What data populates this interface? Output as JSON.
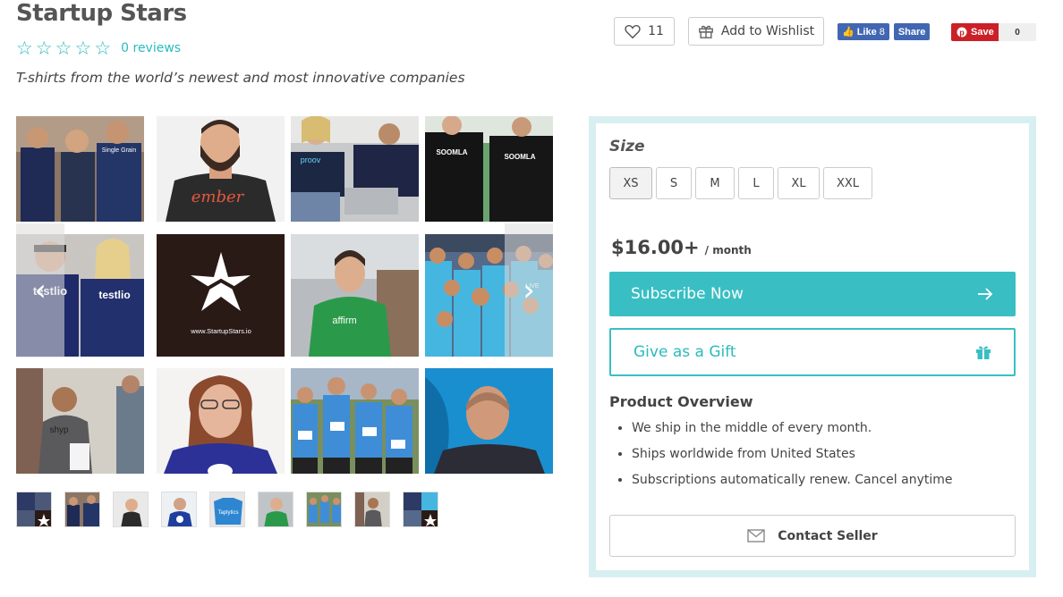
{
  "product": {
    "title": "Startup Stars",
    "rating_stars": 5,
    "reviews_text": "0 reviews",
    "tagline": "T-shirts from the world’s newest and most innovative companies"
  },
  "actions": {
    "like_count": "11",
    "wishlist_label": "Add to Wishlist",
    "fb_like_label": "Like",
    "fb_like_count": "8",
    "fb_share_label": "Share",
    "pin_label": "Save",
    "pin_count": "0"
  },
  "gallery": {
    "tiles": [
      {
        "name": "tile-single-grain",
        "text": "Single Grain"
      },
      {
        "name": "tile-ember",
        "text": "ember"
      },
      {
        "name": "tile-proov",
        "text": "proov"
      },
      {
        "name": "tile-soomla",
        "text": "SOOMLA"
      },
      {
        "name": "tile-testlio",
        "text": "testlio"
      },
      {
        "name": "tile-startupstars-logo",
        "text": "www.StartupStars.io"
      },
      {
        "name": "tile-affirm",
        "text": "affirm"
      },
      {
        "name": "tile-team-photo",
        "text": ""
      },
      {
        "name": "tile-shyp",
        "text": "shyp"
      },
      {
        "name": "tile-woman-smiling",
        "text": ""
      },
      {
        "name": "tile-race-group",
        "text": ""
      },
      {
        "name": "tile-man-blue-bg",
        "text": ""
      }
    ],
    "thumb_count": 9
  },
  "panel": {
    "size_label": "Size",
    "sizes": [
      "XS",
      "S",
      "M",
      "L",
      "XL",
      "XXL"
    ],
    "selected_size": "XS",
    "price": "$16.00+",
    "price_period": "/ month",
    "subscribe_label": "Subscribe Now",
    "gift_label": "Give as a Gift",
    "overview_title": "Product Overview",
    "overview_items": [
      "We ship in the middle of every month.",
      "Ships worldwide from United States",
      "Subscriptions automatically renew. Cancel anytime"
    ],
    "contact_label": "Contact Seller"
  },
  "colors": {
    "accent": "#39bfc3",
    "panel_border": "#d8eff1",
    "facebook": "#4267b2",
    "pinterest": "#cb2027"
  }
}
